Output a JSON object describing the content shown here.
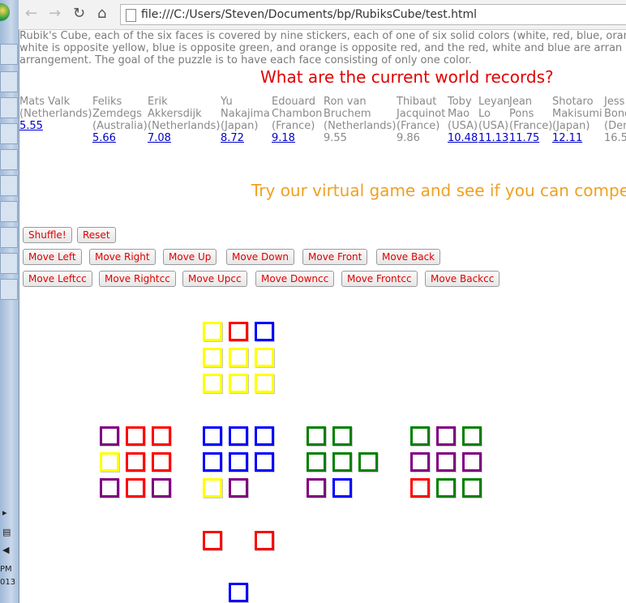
{
  "browser": {
    "back_icon": "back-arrow",
    "forward_icon": "forward-arrow",
    "reload_icon": "reload",
    "home_icon": "home",
    "url": "file:///C:/Users/Steven/Documents/bp/RubiksCube/test.html"
  },
  "taskbar": {
    "time_partial": "PM",
    "date_partial": "013"
  },
  "intro": {
    "line1": "Rubik's Cube, each of the six faces is covered by nine stickers, each of one of six solid colors (white, red, blue, oran",
    "line2": "white is opposite yellow, blue is opposite green, and orange is opposite red, and the red, white and blue are arran",
    "line3": "arrangement. The goal of the puzzle is to have each face consisting of only one color."
  },
  "records_heading": "What are the current world records?",
  "records": [
    {
      "lines": [
        "Mats Valk",
        "(Netherlands)"
      ],
      "time": "5.55",
      "link": true
    },
    {
      "lines": [
        "Feliks",
        "Zemdegs",
        "(Australia)"
      ],
      "time": "5.66",
      "link": true
    },
    {
      "lines": [
        "Erik",
        "Akkersdijk",
        "(Netherlands)"
      ],
      "time": "7.08",
      "link": true
    },
    {
      "lines": [
        "Yu",
        "Nakajima",
        "(Japan)"
      ],
      "time": "8.72",
      "link": true
    },
    {
      "lines": [
        "Edouard",
        "Chambon",
        "(France)"
      ],
      "time": "9.18",
      "link": true
    },
    {
      "lines": [
        "Ron van",
        "Bruchem",
        "(Netherlands)"
      ],
      "time": "9.55",
      "link": false
    },
    {
      "lines": [
        "Thibaut",
        "Jacquinot",
        "(France)"
      ],
      "time": "9.86",
      "link": false
    },
    {
      "lines": [
        "Toby",
        "Mao",
        "(USA)"
      ],
      "time": "10.48",
      "link": true
    },
    {
      "lines": [
        "Leyan",
        "Lo",
        "(USA)"
      ],
      "time": "11.13",
      "link": true
    },
    {
      "lines": [
        "Jean",
        "Pons",
        "(France)"
      ],
      "time": "11.75",
      "link": true
    },
    {
      "lines": [
        "Shotaro",
        "Makisumi",
        "(Japan)"
      ],
      "time": "12.11",
      "link": true
    },
    {
      "lines": [
        "Jess",
        "Bonde",
        "(Den"
      ],
      "time": "16.5",
      "link": false
    }
  ],
  "game_heading": "Try our virtual game and see if you can compe",
  "buttons": {
    "shuffle": "Shuffle!",
    "reset": "Reset",
    "left": "Move Left",
    "right": "Move Right",
    "up": "Move Up",
    "down": "Move Down",
    "front": "Move Front",
    "back": "Move Back",
    "leftcc": "Move Leftcc",
    "rightcc": "Move Rightcc",
    "upcc": "Move Upcc",
    "downcc": "Move Downcc",
    "frontcc": "Move Frontcc",
    "backcc": "Move Backcc"
  },
  "colors": {
    "yellow": "#ffff00",
    "red": "#ff0000",
    "blue": "#0000ff",
    "green": "#008000",
    "purple": "#800080",
    "white": "#ffffff"
  },
  "cube_faces": [
    {
      "name": "top",
      "stickers": [
        [
          "yellow",
          "red",
          "blue"
        ],
        [
          "yellow",
          "yellow",
          "yellow"
        ],
        [
          "yellow",
          "yellow",
          "yellow"
        ]
      ]
    },
    {
      "name": "left",
      "stickers": [
        [
          "purple",
          "red",
          "red"
        ],
        [
          "yellow",
          "red",
          "red"
        ],
        [
          "purple",
          "red",
          "purple"
        ]
      ]
    },
    {
      "name": "front",
      "stickers": [
        [
          "blue",
          "blue",
          "blue"
        ],
        [
          "blue",
          "blue",
          "blue"
        ],
        [
          "yellow",
          "purple",
          "white"
        ]
      ]
    },
    {
      "name": "right",
      "stickers": [
        [
          "green",
          "green",
          "white"
        ],
        [
          "green",
          "green",
          "green"
        ],
        [
          "purple",
          "blue",
          "white"
        ]
      ]
    },
    {
      "name": "back",
      "stickers": [
        [
          "green",
          "purple",
          "green"
        ],
        [
          "purple",
          "purple",
          "purple"
        ],
        [
          "red",
          "green",
          "green"
        ]
      ]
    },
    {
      "name": "bottom",
      "stickers": [
        [
          "red",
          "white",
          "red"
        ],
        [
          "white",
          "white",
          "white"
        ],
        [
          "white",
          "blue",
          "white"
        ]
      ]
    }
  ]
}
